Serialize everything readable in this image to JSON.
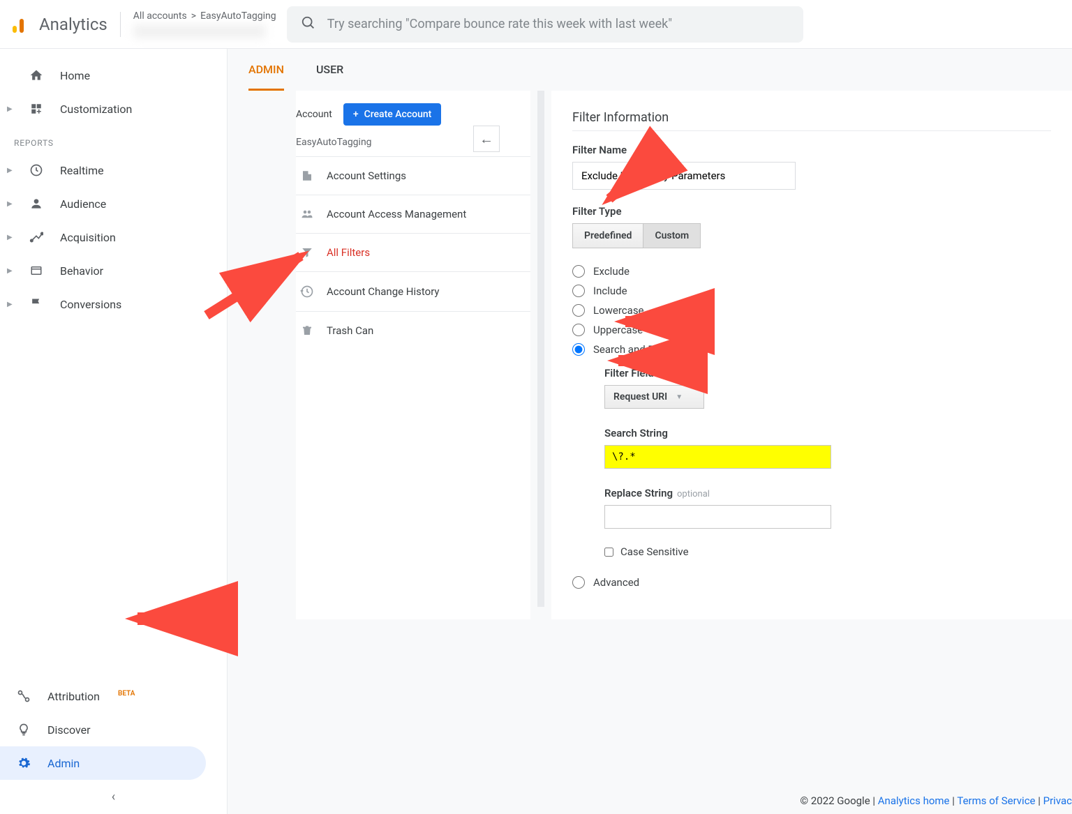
{
  "header": {
    "app_name": "Analytics",
    "breadcrumb_all": "All accounts",
    "breadcrumb_sep": ">",
    "breadcrumb_account": "EasyAutoTagging",
    "search_placeholder": "Try searching \"Compare bounce rate this week with last week\""
  },
  "sidebar": {
    "home": "Home",
    "customization": "Customization",
    "reports_label": "REPORTS",
    "realtime": "Realtime",
    "audience": "Audience",
    "acquisition": "Acquisition",
    "behavior": "Behavior",
    "conversions": "Conversions",
    "attribution": "Attribution",
    "attribution_badge": "BETA",
    "discover": "Discover",
    "admin": "Admin"
  },
  "tabs": {
    "admin": "ADMIN",
    "user": "USER"
  },
  "account_col": {
    "label": "Account",
    "create_btn": "Create Account",
    "account_name": "EasyAutoTagging",
    "items": {
      "settings": "Account Settings",
      "access": "Account Access Management",
      "filters": "All Filters",
      "history": "Account Change History",
      "trash": "Trash Can"
    }
  },
  "filter": {
    "section_title": "Filter Information",
    "name_label": "Filter Name",
    "name_value": "Exclude URL Query Parameters",
    "type_label": "Filter Type",
    "predefined": "Predefined",
    "custom": "Custom",
    "radios": {
      "exclude": "Exclude",
      "include": "Include",
      "lowercase": "Lowercase",
      "uppercase": "Uppercase",
      "search_replace": "Search and Replace",
      "advanced": "Advanced"
    },
    "filter_field_label": "Filter Field",
    "filter_field_value": "Request URI",
    "search_string_label": "Search String",
    "search_string_value": "\\?.*",
    "replace_string_label": "Replace String",
    "replace_optional": "optional",
    "case_sensitive": "Case Sensitive"
  },
  "footer": {
    "copyright": "© 2022 Google | ",
    "analytics_home": "Analytics home",
    "terms": "Terms of Service",
    "privacy": "Privac",
    "sep": " | "
  }
}
